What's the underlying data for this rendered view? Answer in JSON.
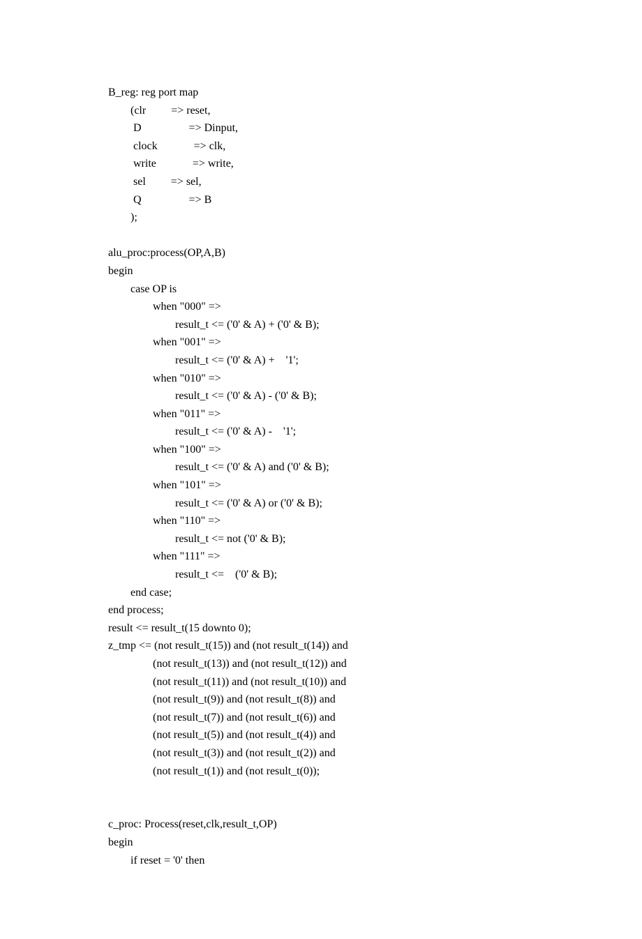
{
  "lines": [
    "B_reg: reg port map",
    "        (clr         => reset,",
    "         D                 => Dinput,",
    "         clock             => clk,",
    "         write             => write,",
    "         sel         => sel,",
    "         Q                 => B",
    "        );",
    "",
    "alu_proc:process(OP,A,B)",
    "begin",
    "        case OP is",
    "                when \"000\" =>",
    "                        result_t <= ('0' & A) + ('0' & B);",
    "                when \"001\" =>",
    "                        result_t <= ('0' & A) +    '1';",
    "                when \"010\" =>",
    "                        result_t <= ('0' & A) - ('0' & B);",
    "                when \"011\" =>",
    "                        result_t <= ('0' & A) -    '1';",
    "                when \"100\" =>",
    "                        result_t <= ('0' & A) and ('0' & B);",
    "                when \"101\" =>",
    "                        result_t <= ('0' & A) or ('0' & B);",
    "                when \"110\" =>",
    "                        result_t <= not ('0' & B);",
    "                when \"111\" =>",
    "                        result_t <=    ('0' & B);",
    "        end case;",
    "end process;",
    "result <= result_t(15 downto 0);",
    "z_tmp <= (not result_t(15)) and (not result_t(14)) and",
    "                (not result_t(13)) and (not result_t(12)) and",
    "                (not result_t(11)) and (not result_t(10)) and",
    "                (not result_t(9)) and (not result_t(8)) and",
    "                (not result_t(7)) and (not result_t(6)) and",
    "                (not result_t(5)) and (not result_t(4)) and",
    "                (not result_t(3)) and (not result_t(2)) and",
    "                (not result_t(1)) and (not result_t(0));",
    "",
    "",
    "c_proc: Process(reset,clk,result_t,OP)",
    "begin",
    "        if reset = '0' then"
  ]
}
